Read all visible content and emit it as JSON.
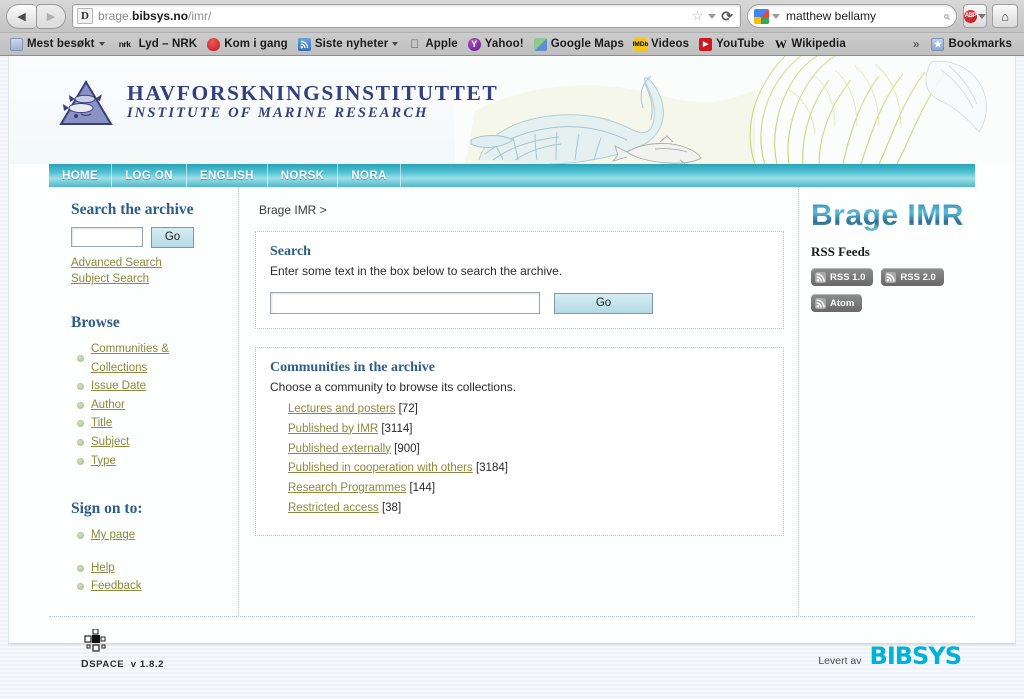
{
  "browser": {
    "back_label": "◀",
    "forward_label": "▶",
    "site_icon_letter": "D",
    "url_prefix": "brage.",
    "url_domain": "bibsys.no",
    "url_path": "/imr/",
    "star_glyph": "☆",
    "reload_glyph": "⟳",
    "search_value": "matthew bellamy",
    "search_mag_glyph": "⌕",
    "adblock_label": "ABP",
    "home_glyph": "⌂",
    "bookmarks": [
      {
        "label": "Mest besøkt",
        "icon": "folder-icon",
        "dropdown": true
      },
      {
        "label": "Lyd – NRK",
        "icon": "nrk-icon",
        "icon_text": "nrk",
        "dropdown": false
      },
      {
        "label": "Kom i gang",
        "icon": "firefox-icon",
        "dropdown": false
      },
      {
        "label": "Siste nyheter",
        "icon": "rss-icon",
        "dropdown": true
      },
      {
        "label": "Apple",
        "icon": "apple-icon",
        "icon_text": "",
        "dropdown": false
      },
      {
        "label": "Yahoo!",
        "icon": "yahoo-icon",
        "icon_text": "Y",
        "dropdown": false
      },
      {
        "label": "Google Maps",
        "icon": "google-maps-icon",
        "dropdown": false
      },
      {
        "label": "Videos",
        "icon": "imdb-icon",
        "icon_text": "IMDb",
        "dropdown": false
      },
      {
        "label": "YouTube",
        "icon": "youtube-icon",
        "icon_text": "▶",
        "dropdown": false
      },
      {
        "label": "Wikipedia",
        "icon": "wikipedia-icon",
        "icon_text": "W",
        "dropdown": false
      }
    ],
    "overflow_glyph": "»",
    "bookmarks_label": "Bookmarks",
    "bookmarks_icon_glyph": "★"
  },
  "site": {
    "logo_title": "HAVFORSKNINGSINSTITUTTET",
    "logo_subtitle": "INSTITUTE OF MARINE RESEARCH",
    "nav": [
      {
        "label": "HOME"
      },
      {
        "label": "LOG ON"
      },
      {
        "label": "ENGLISH"
      },
      {
        "label": "NORSK"
      },
      {
        "label": "NORA"
      }
    ]
  },
  "sidebar": {
    "search_heading": "Search the archive",
    "search_value": "",
    "go_label": "Go",
    "links": [
      {
        "label": "Advanced Search"
      },
      {
        "label": "Subject Search"
      }
    ],
    "browse_heading": "Browse",
    "browse_items": [
      {
        "label": "Communities & Collections"
      },
      {
        "label": "Issue Date"
      },
      {
        "label": "Author"
      },
      {
        "label": "Title"
      },
      {
        "label": "Subject"
      },
      {
        "label": "Type"
      }
    ],
    "signon_heading": "Sign on to:",
    "signon_items": [
      {
        "label": "My page"
      }
    ],
    "help_items": [
      {
        "label": "Help"
      },
      {
        "label": "Feedback"
      }
    ]
  },
  "main": {
    "breadcrumb": "Brage IMR >",
    "search_panel": {
      "heading": "Search",
      "description": "Enter some text in the box below to search the archive.",
      "input_value": "",
      "go_label": "Go"
    },
    "communities_panel": {
      "heading": "Communities in the archive",
      "description": "Choose a community to browse its collections.",
      "items": [
        {
          "label": "Lectures and posters",
          "count": "[72]"
        },
        {
          "label": "Published by IMR",
          "count": "[3114]"
        },
        {
          "label": "Published externally",
          "count": "[900]"
        },
        {
          "label": "Published in cooperation with others",
          "count": "[3184]"
        },
        {
          "label": "Research Programmes",
          "count": "[144]"
        },
        {
          "label": "Restricted access",
          "count": "[38]"
        }
      ]
    }
  },
  "rightbar": {
    "logo_text": "Brage IMR",
    "rss_heading": "RSS Feeds",
    "feeds": [
      {
        "label": "RSS 1.0"
      },
      {
        "label": "RSS 2.0"
      },
      {
        "label": "Atom"
      }
    ]
  },
  "footer": {
    "dspace_d": "D",
    "dspace_space": "SPACE",
    "dspace_version": "v 1.8.2",
    "levert_label": "Levert av",
    "bibsys_label": "BIBSYS"
  },
  "colors": {
    "nav_teal": "#4fb7c9",
    "heading_blue": "#2f5d8a",
    "link_olive": "#8a8a3c",
    "bibsys_cyan": "#00b2d6",
    "imr_purple": "#353f7f"
  }
}
